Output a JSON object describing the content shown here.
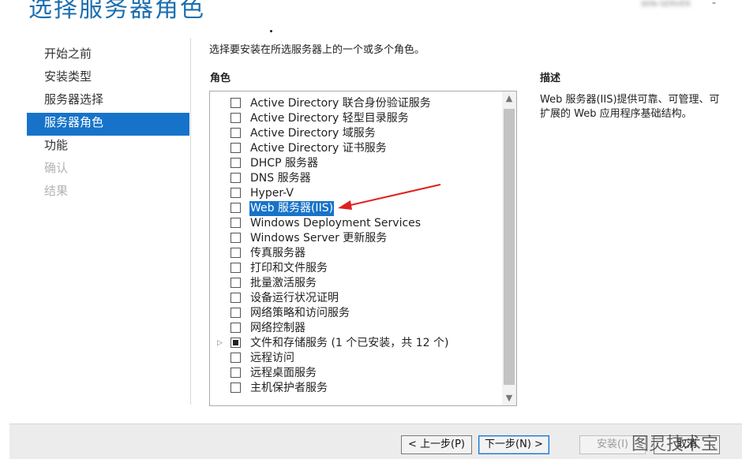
{
  "page_title": "选择服务器角色",
  "server_name": "WIN-SERVER",
  "nav": [
    {
      "label": "开始之前",
      "state": "normal"
    },
    {
      "label": "安装类型",
      "state": "normal"
    },
    {
      "label": "服务器选择",
      "state": "normal"
    },
    {
      "label": "服务器角色",
      "state": "active"
    },
    {
      "label": "功能",
      "state": "normal"
    },
    {
      "label": "确认",
      "state": "disabled"
    },
    {
      "label": "结果",
      "state": "disabled"
    }
  ],
  "instruction": "选择要安装在所选服务器上的一个或多个角色。",
  "roles_header": "角色",
  "description_header": "描述",
  "description": "Web 服务器(IIS)提供可靠、可管理、可扩展的 Web 应用程序基础结构。",
  "roles": [
    {
      "label": "Active Directory 联合身份验证服务",
      "checked": false
    },
    {
      "label": "Active Directory 轻型目录服务",
      "checked": false
    },
    {
      "label": "Active Directory 域服务",
      "checked": false
    },
    {
      "label": "Active Directory 证书服务",
      "checked": false
    },
    {
      "label": "DHCP 服务器",
      "checked": false
    },
    {
      "label": "DNS 服务器",
      "checked": false
    },
    {
      "label": "Hyper-V",
      "checked": false
    },
    {
      "label": "Web 服务器(IIS)",
      "checked": false,
      "selected": true
    },
    {
      "label": "Windows Deployment Services",
      "checked": false
    },
    {
      "label": "Windows Server 更新服务",
      "checked": false
    },
    {
      "label": "传真服务器",
      "checked": false
    },
    {
      "label": "打印和文件服务",
      "checked": false
    },
    {
      "label": "批量激活服务",
      "checked": false
    },
    {
      "label": "设备运行状况证明",
      "checked": false
    },
    {
      "label": "网络策略和访问服务",
      "checked": false
    },
    {
      "label": "网络控制器",
      "checked": false
    },
    {
      "label": "文件和存储服务 (1 个已安装，共 12 个)",
      "checked": "partial",
      "expandable": true
    },
    {
      "label": "远程访问",
      "checked": false
    },
    {
      "label": "远程桌面服务",
      "checked": false
    },
    {
      "label": "主机保护者服务",
      "checked": false
    }
  ],
  "buttons": {
    "previous": "< 上一步(P)",
    "next": "下一步(N) >",
    "install": "安装(I)",
    "cancel": "取消"
  },
  "watermark": "图灵技术宝",
  "colors": {
    "accent": "#1773c9",
    "title": "#1c6fb0",
    "arrow": "#e02020"
  }
}
